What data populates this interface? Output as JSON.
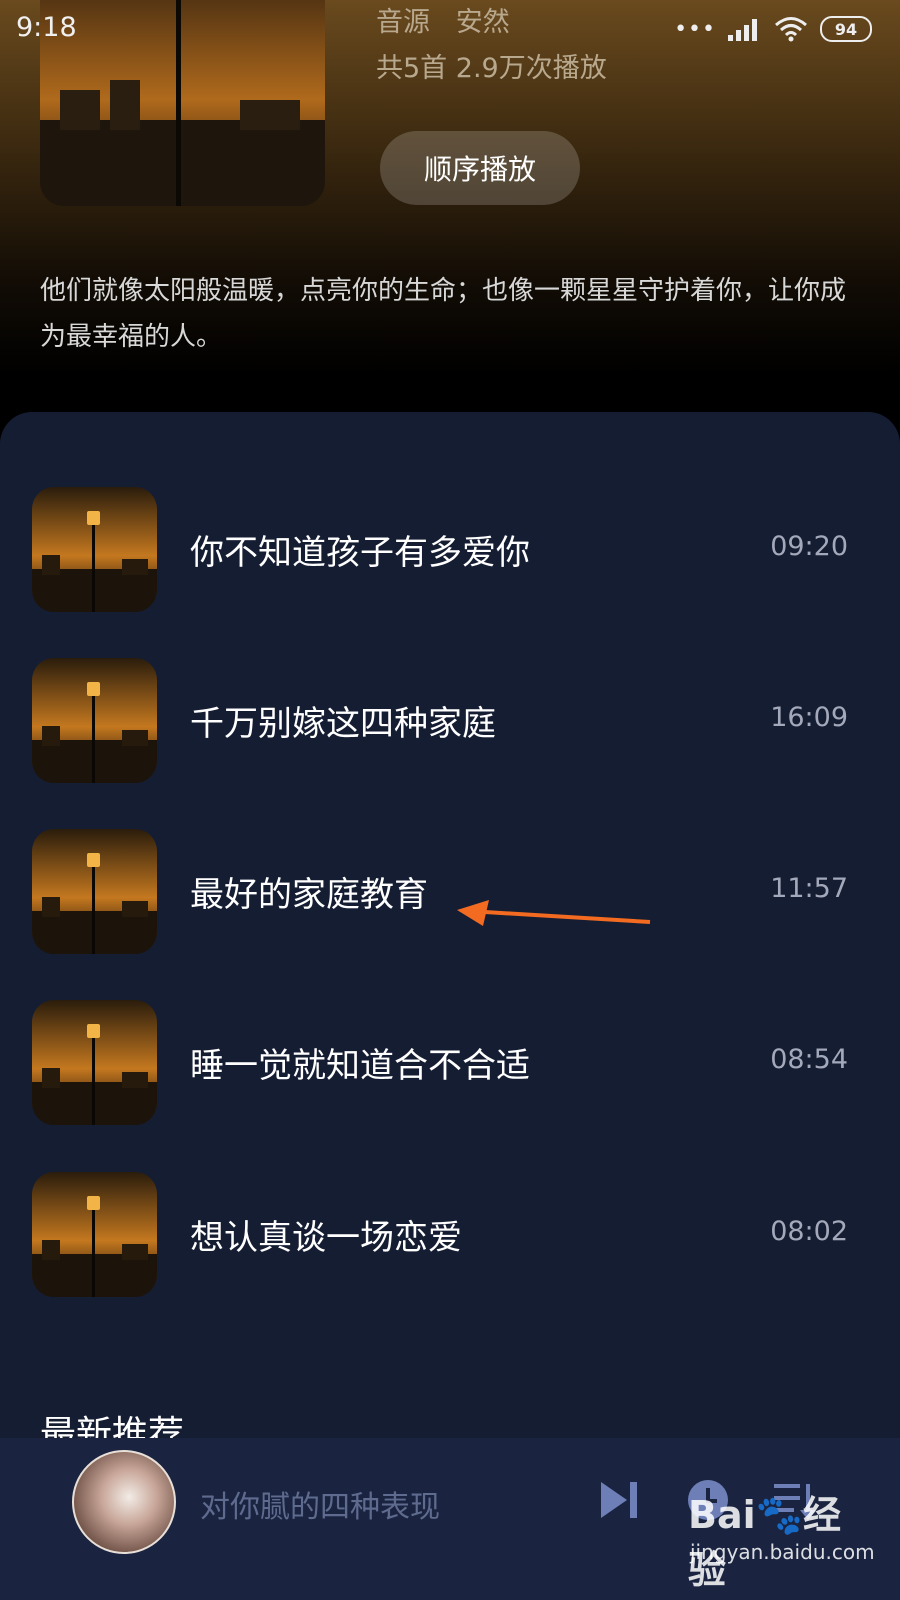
{
  "status_bar": {
    "time": "9:18",
    "battery": "94"
  },
  "album": {
    "source_label": "音源",
    "source_name": "安然",
    "stats": "共5首  2.9万次播放",
    "play_button": "顺序播放",
    "description": "他们就像太阳般温暖，点亮你的生命；也像一颗星星守护着你，让你成为最幸福的人。"
  },
  "tracks": [
    {
      "title": "你不知道孩子有多爱你",
      "duration": "09:20"
    },
    {
      "title": "千万别嫁这四种家庭",
      "duration": "16:09"
    },
    {
      "title": "最好的家庭教育",
      "duration": "11:57"
    },
    {
      "title": "睡一觉就知道合不合适",
      "duration": "08:54"
    },
    {
      "title": "想认真谈一场恋爱",
      "duration": "08:02"
    }
  ],
  "section": {
    "latest_title": "最新推荐"
  },
  "player": {
    "now_playing": "对你腻的四种表现"
  },
  "watermark": {
    "brand_left": "Bai",
    "brand_right": "经验",
    "url": "jingyan.baidu.com"
  },
  "icons": {
    "next": "skip-next-icon",
    "timer": "clock-icon",
    "playlist": "playlist-icon",
    "lamp": "street-lamp-image",
    "arrow": "annotation-arrow"
  },
  "colors": {
    "panel": "#151d33",
    "player": "#1a2440",
    "accent_arrow": "#f26b21"
  }
}
